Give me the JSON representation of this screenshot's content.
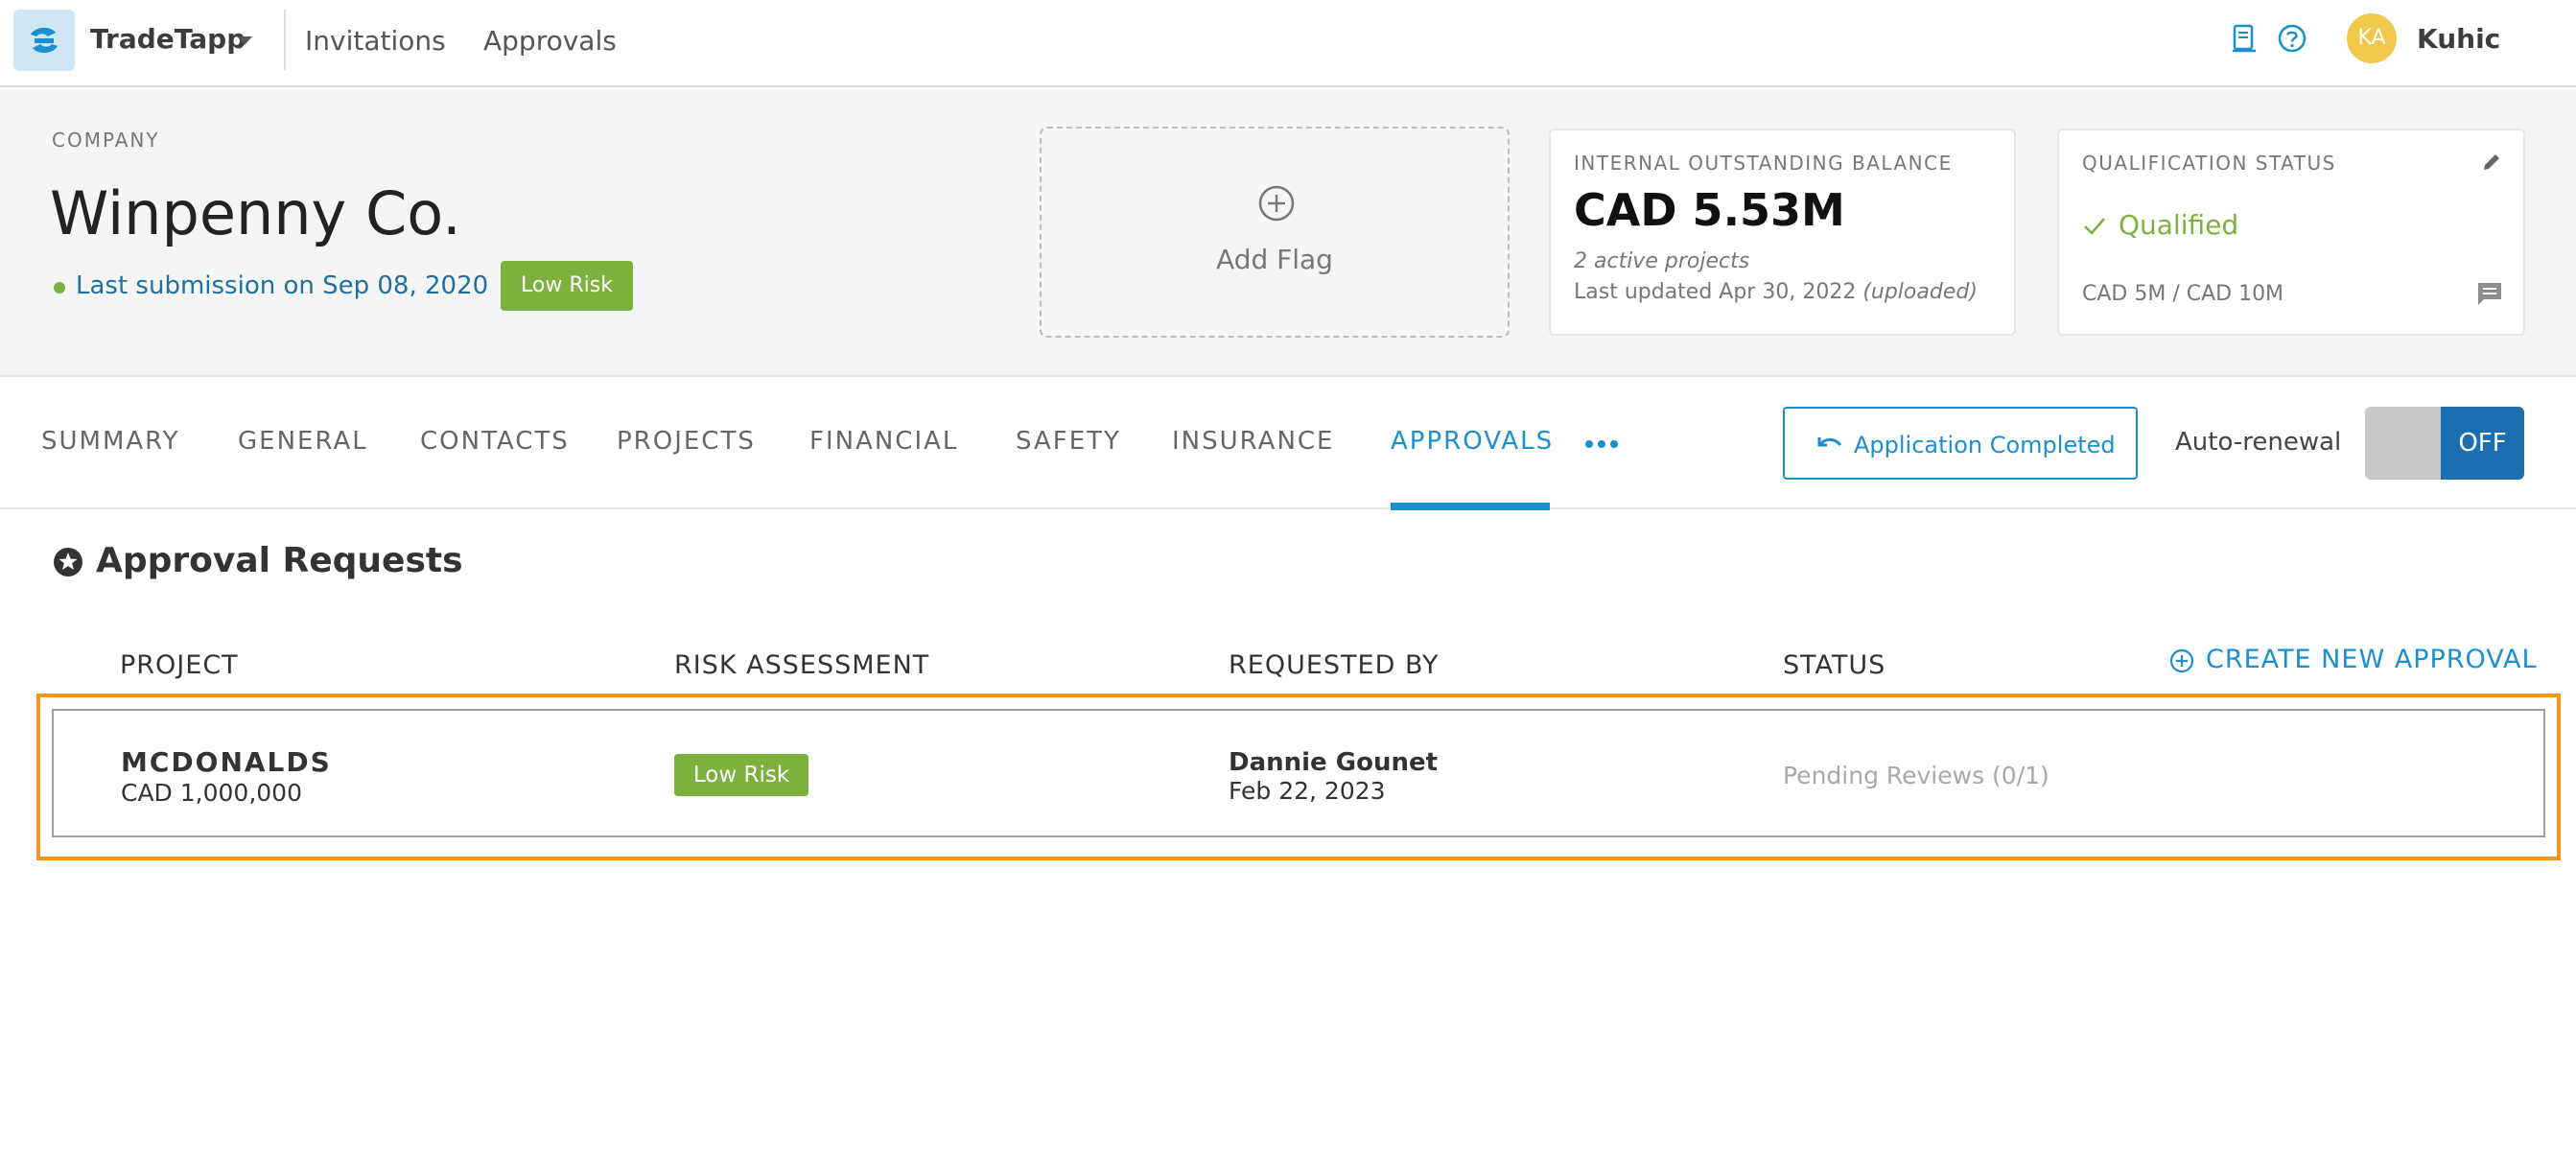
{
  "header": {
    "brand": "TradeTapp",
    "nav": [
      "Invitations",
      "Approvals"
    ],
    "user": {
      "initials": "KA",
      "name": "Kuhic"
    },
    "icons": [
      "document-icon",
      "help-icon"
    ]
  },
  "company": {
    "label": "COMPANY",
    "name": "Winpenny Co.",
    "last_submission": "Last submission on Sep 08, 2020",
    "risk": "Low Risk",
    "add_flag": "Add Flag"
  },
  "balance_card": {
    "caption": "INTERNAL OUTSTANDING BALANCE",
    "value": "CAD 5.53M",
    "active_count": "2",
    "active_text": " active projects",
    "updated": "Last updated Apr 30, 2022 ",
    "updated_note": "(uploaded)"
  },
  "qualification_card": {
    "caption": "QUALIFICATION STATUS",
    "status": "Qualified",
    "range": "CAD 5M / CAD 10M"
  },
  "tabs": [
    "SUMMARY",
    "GENERAL",
    "CONTACTS",
    "PROJECTS",
    "FINANCIAL",
    "SAFETY",
    "INSURANCE",
    "APPROVALS"
  ],
  "active_tab": "APPROVALS",
  "actions": {
    "application_completed": "Application Completed",
    "auto_renewal_label": "Auto-renewal",
    "auto_renewal_state": "OFF"
  },
  "approvals": {
    "title": "Approval Requests",
    "columns": [
      "PROJECT",
      "RISK ASSESSMENT",
      "REQUESTED BY",
      "STATUS"
    ],
    "create_label": "CREATE NEW APPROVAL",
    "rows": [
      {
        "project": "MCDONALDS",
        "amount": "CAD 1,000,000",
        "risk": "Low Risk",
        "requested_by": "Dannie Gounet",
        "requested_on": "Feb 22, 2023",
        "status": "Pending Reviews (0/1)"
      }
    ]
  },
  "colors": {
    "accent": "#1b8fd0",
    "success": "#7bb13c",
    "highlight": "#f7941d",
    "toggle_on": "#1b6eb0"
  }
}
